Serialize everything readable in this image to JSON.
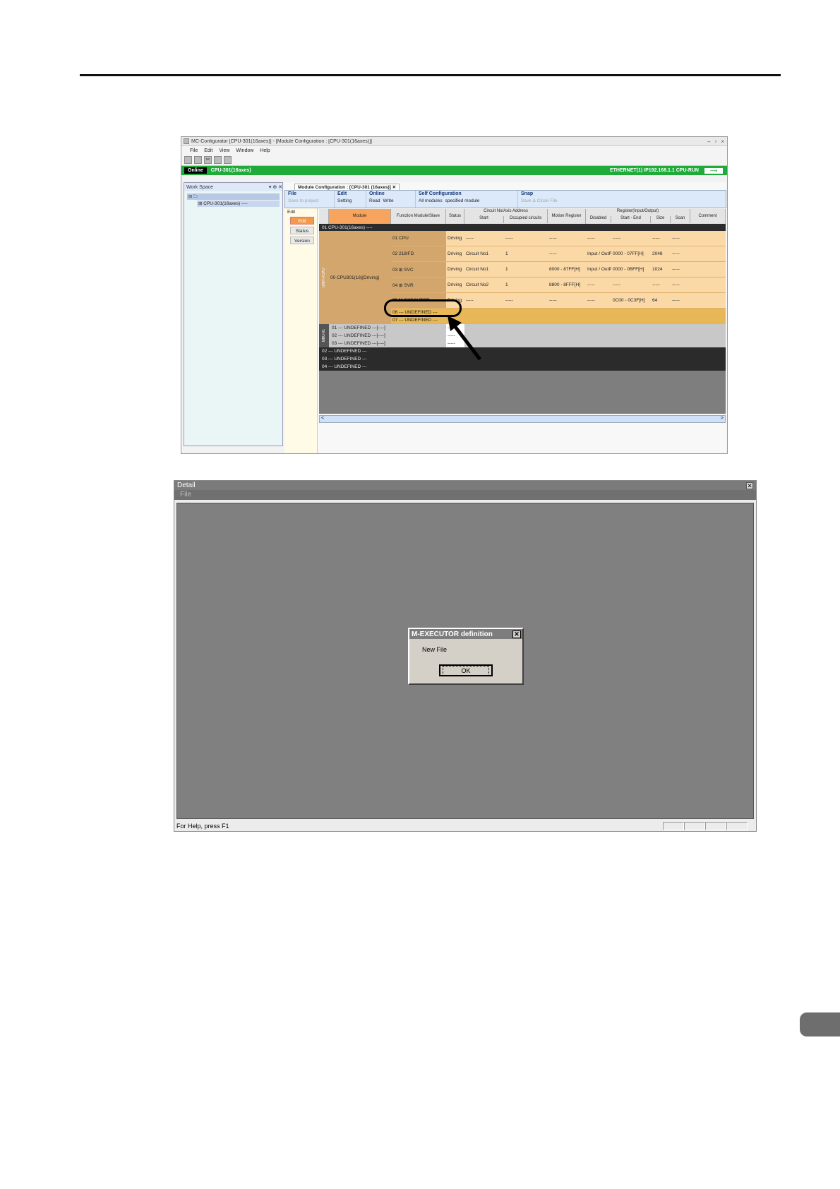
{
  "app": {
    "title": "MC-Configurator [CPU-301(16axes)] - [Module Configuration : [CPU-301(16axes)]]",
    "menu": [
      "File",
      "Edit",
      "View",
      "Window",
      "Help"
    ],
    "toolbar_icons": [
      "new-icon",
      "open-icon",
      "cut-icon",
      "copy-icon",
      "paste-icon"
    ]
  },
  "online_bar": {
    "badge": "Online",
    "cpu": "CPU-301(16axes)",
    "connection": "ETHERNET(1) IP192.168.1.1 CPU-RUN",
    "arrow": "⟶"
  },
  "workspace": {
    "title": "Work Space",
    "controls": "▾ ⊕ ✕",
    "root": "⊟ 🗀",
    "node": "⊞ CPU-301(16axes) ----"
  },
  "doc_tab": "Module Configuration : [CPU-301 (16axes)] ✕",
  "ribbon": [
    {
      "title": "File",
      "items": [
        {
          "label": "Save to project",
          "disabled": true
        }
      ]
    },
    {
      "title": "Edit",
      "items": [
        {
          "label": "Setting",
          "disabled": false
        }
      ]
    },
    {
      "title": "Online",
      "items": [
        {
          "label": "Read",
          "disabled": false
        },
        {
          "label": "Write",
          "disabled": false
        }
      ]
    },
    {
      "title": "Self Configuration",
      "items": [
        {
          "label": "All modules",
          "disabled": false
        },
        {
          "label": "specified module",
          "disabled": false
        }
      ]
    },
    {
      "title": "Snap",
      "items": [
        {
          "label": "Save & Close File",
          "disabled": true
        }
      ]
    }
  ],
  "left_nav": {
    "head": "Edit",
    "buttons": [
      "Edit",
      "Status",
      "Version"
    ]
  },
  "grid_headers": {
    "module": "Module",
    "function": "Function Module/Slave",
    "status": "Status",
    "circuit": "Circuit No/Axis Address",
    "circuit_start": "Start",
    "circuit_occupied": "Occupied circuits",
    "motion_register": "Motion Register",
    "register": "Register(Input/Output)",
    "reg_disabled": "Disabled",
    "reg_start_end": "Start - End",
    "reg_size": "Size",
    "reg_scan": "Scan",
    "comment": "Comment"
  },
  "grid": {
    "top_row": "01 CPU-301(16axes) ----",
    "group_label": "00 CPU301(16)[Driving]",
    "group_side": "UNIT-VCPU",
    "rows": [
      {
        "fn": "01 CPU",
        "status": "Driving",
        "circuit": "-----",
        "occupied": "-----",
        "motion": "-----",
        "disabled": "-----",
        "start_end": "-----",
        "size": "-----",
        "scan": "-----"
      },
      {
        "fn": "02 218IFD",
        "status": "Driving",
        "circuit": "Circuit No1",
        "occupied": "1",
        "motion": "-----",
        "disabled": "Input / OutPut",
        "start_end": "0000 - 07FF[H]",
        "size": "2048",
        "scan": "-----"
      },
      {
        "fn": "03 ⊞ SVC",
        "status": "Driving",
        "circuit": "Circuit No1",
        "occupied": "1",
        "motion": "8000 - 87FF[H]",
        "disabled": "Input / OutPut",
        "start_end": "0000 - 0BFF[H]",
        "size": "1024",
        "scan": "-----"
      },
      {
        "fn": "04 ⊞ SVR",
        "status": "Driving",
        "circuit": "Circuit No2",
        "occupied": "1",
        "motion": "8800 - 8FFF[H]",
        "disabled": "-----",
        "start_end": "-----",
        "size": "-----",
        "scan": "-----"
      },
      {
        "fn": "05 M-EXECUTOR",
        "status": "Driving",
        "circuit": "-----",
        "occupied": "-----",
        "motion": "-----",
        "disabled": "-----",
        "start_end": "0C00 - 0C3F[H]",
        "size": "64",
        "scan": "-----"
      },
      {
        "fn": "06 --- UNDEFINED ---",
        "status": "",
        "circuit": "",
        "occupied": "",
        "motion": "",
        "disabled": "",
        "start_end": "",
        "size": "",
        "scan": ""
      },
      {
        "fn": "07 --- UNDEFINED ---",
        "status": "",
        "circuit": "",
        "occupied": "",
        "motion": "",
        "disabled": "",
        "start_end": "",
        "size": "",
        "scan": ""
      }
    ],
    "undefined_slots": [
      "01 --- UNDEFINED ---[----]",
      "02 --- UNDEFINED ---[----]",
      "03 --- UNDEFINED ---[----]"
    ],
    "slot_status": "-----",
    "undefined_side": "MBU-01",
    "bottom_rows": [
      "02 --- UNDEFINED ---",
      "03 --- UNDEFINED ---",
      "04 --- UNDEFINED ---"
    ]
  },
  "scroll": {
    "left": "<",
    "right": ">"
  },
  "detail_window": {
    "title": "Detail",
    "close": "✕",
    "menu": "File",
    "status_text": "For Help, press F1"
  },
  "dialog": {
    "title": "M-EXECUTOR definition",
    "close": "✕",
    "message": "New File",
    "ok": "OK"
  }
}
